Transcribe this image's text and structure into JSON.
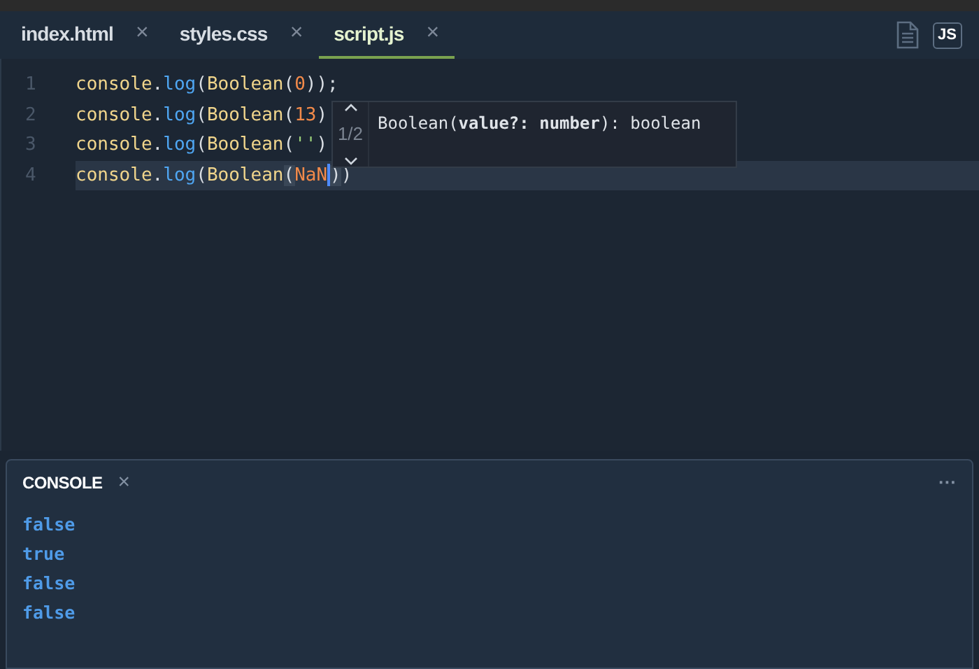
{
  "tabs": [
    {
      "label": "index.html",
      "selected": false,
      "close": "×"
    },
    {
      "label": "styles.css",
      "selected": false,
      "close": "×"
    },
    {
      "label": "script.js",
      "selected": true,
      "close": "×"
    }
  ],
  "toolbar": {
    "badge": "JS"
  },
  "editor": {
    "lines": [
      {
        "number": "1",
        "current": false,
        "tokens": [
          {
            "kind": "name",
            "text": "console"
          },
          {
            "kind": "punct",
            "text": "."
          },
          {
            "kind": "method",
            "text": "log"
          },
          {
            "kind": "punct",
            "text": "("
          },
          {
            "kind": "name",
            "text": "Boolean"
          },
          {
            "kind": "punct",
            "text": "("
          },
          {
            "kind": "number",
            "text": "0"
          },
          {
            "kind": "punct",
            "text": "));"
          }
        ]
      },
      {
        "number": "2",
        "current": false,
        "tokens": [
          {
            "kind": "name",
            "text": "console"
          },
          {
            "kind": "punct",
            "text": "."
          },
          {
            "kind": "method",
            "text": "log"
          },
          {
            "kind": "punct",
            "text": "("
          },
          {
            "kind": "name",
            "text": "Boolean"
          },
          {
            "kind": "punct",
            "text": "("
          },
          {
            "kind": "number",
            "text": "13"
          },
          {
            "kind": "punct",
            "text": ")"
          }
        ]
      },
      {
        "number": "3",
        "current": false,
        "tokens": [
          {
            "kind": "name",
            "text": "console"
          },
          {
            "kind": "punct",
            "text": "."
          },
          {
            "kind": "method",
            "text": "log"
          },
          {
            "kind": "punct",
            "text": "("
          },
          {
            "kind": "name",
            "text": "Boolean"
          },
          {
            "kind": "punct",
            "text": "("
          },
          {
            "kind": "string",
            "text": "''"
          },
          {
            "kind": "punct",
            "text": ")"
          }
        ]
      },
      {
        "number": "4",
        "current": true,
        "tokens": [
          {
            "kind": "name",
            "text": "console"
          },
          {
            "kind": "punct",
            "text": "."
          },
          {
            "kind": "method",
            "text": "log"
          },
          {
            "kind": "punct",
            "text": "("
          },
          {
            "kind": "name",
            "text": "Boolean"
          },
          {
            "kind": "match",
            "text": "("
          },
          {
            "kind": "number",
            "text": "NaN"
          },
          {
            "kind": "cursor"
          },
          {
            "kind": "match",
            "text": ")"
          },
          {
            "kind": "punct",
            "text": ")"
          }
        ]
      }
    ],
    "signature": {
      "counter": "1/2",
      "text": "Boolean(**value?: number**): boolean"
    }
  },
  "console": {
    "title": "CONSOLE",
    "close": "×",
    "menu": "···",
    "output": [
      "false",
      "true",
      "false",
      "false"
    ]
  }
}
